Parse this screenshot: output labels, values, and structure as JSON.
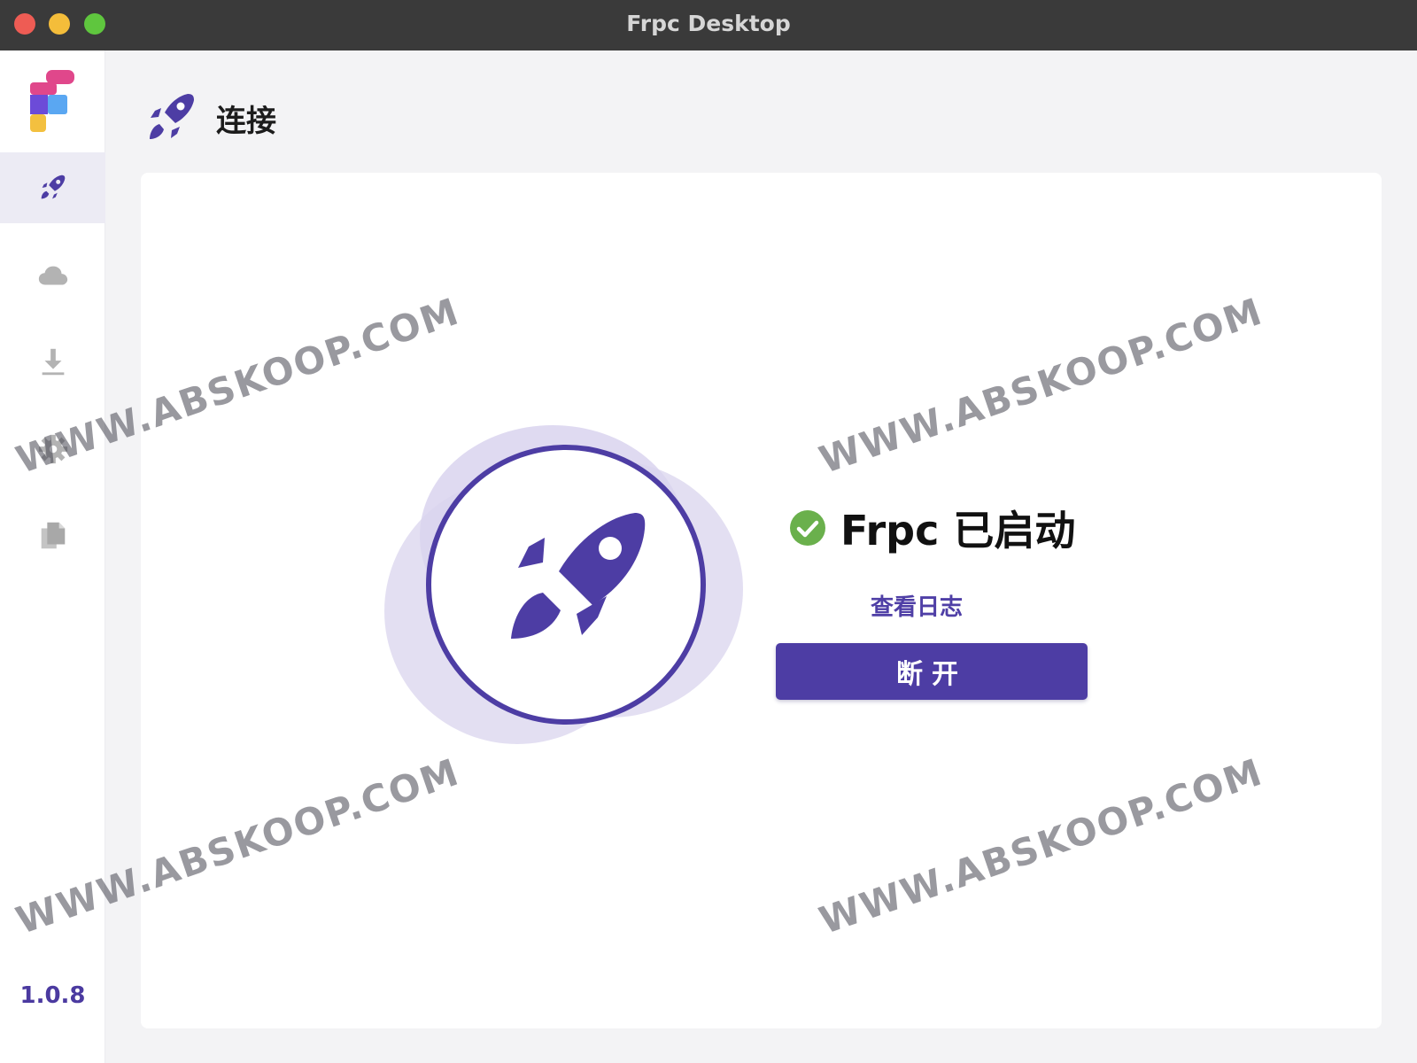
{
  "window": {
    "title": "Frpc Desktop"
  },
  "sidebar": {
    "items": [
      {
        "id": "connect",
        "icon": "rocket-icon",
        "active": true
      },
      {
        "id": "server",
        "icon": "cloud-icon",
        "active": false
      },
      {
        "id": "download",
        "icon": "download-icon",
        "active": false
      },
      {
        "id": "settings",
        "icon": "gear-icon",
        "active": false
      },
      {
        "id": "logs",
        "icon": "documents-icon",
        "active": false
      }
    ],
    "version": "1.0.8"
  },
  "header": {
    "title": "连接",
    "icon": "rocket-icon"
  },
  "main": {
    "status_text": "Frpc 已启动",
    "status_icon": "check-circle-icon",
    "view_log_label": "查看日志",
    "disconnect_label": "断开"
  },
  "watermark": {
    "text": "WWW.ABSKOOP.COM"
  },
  "colors": {
    "accent": "#4d3da4",
    "success": "#6ab04c",
    "titlebar": "#3a3a3a",
    "active_nav_bg": "#ecebf4"
  }
}
